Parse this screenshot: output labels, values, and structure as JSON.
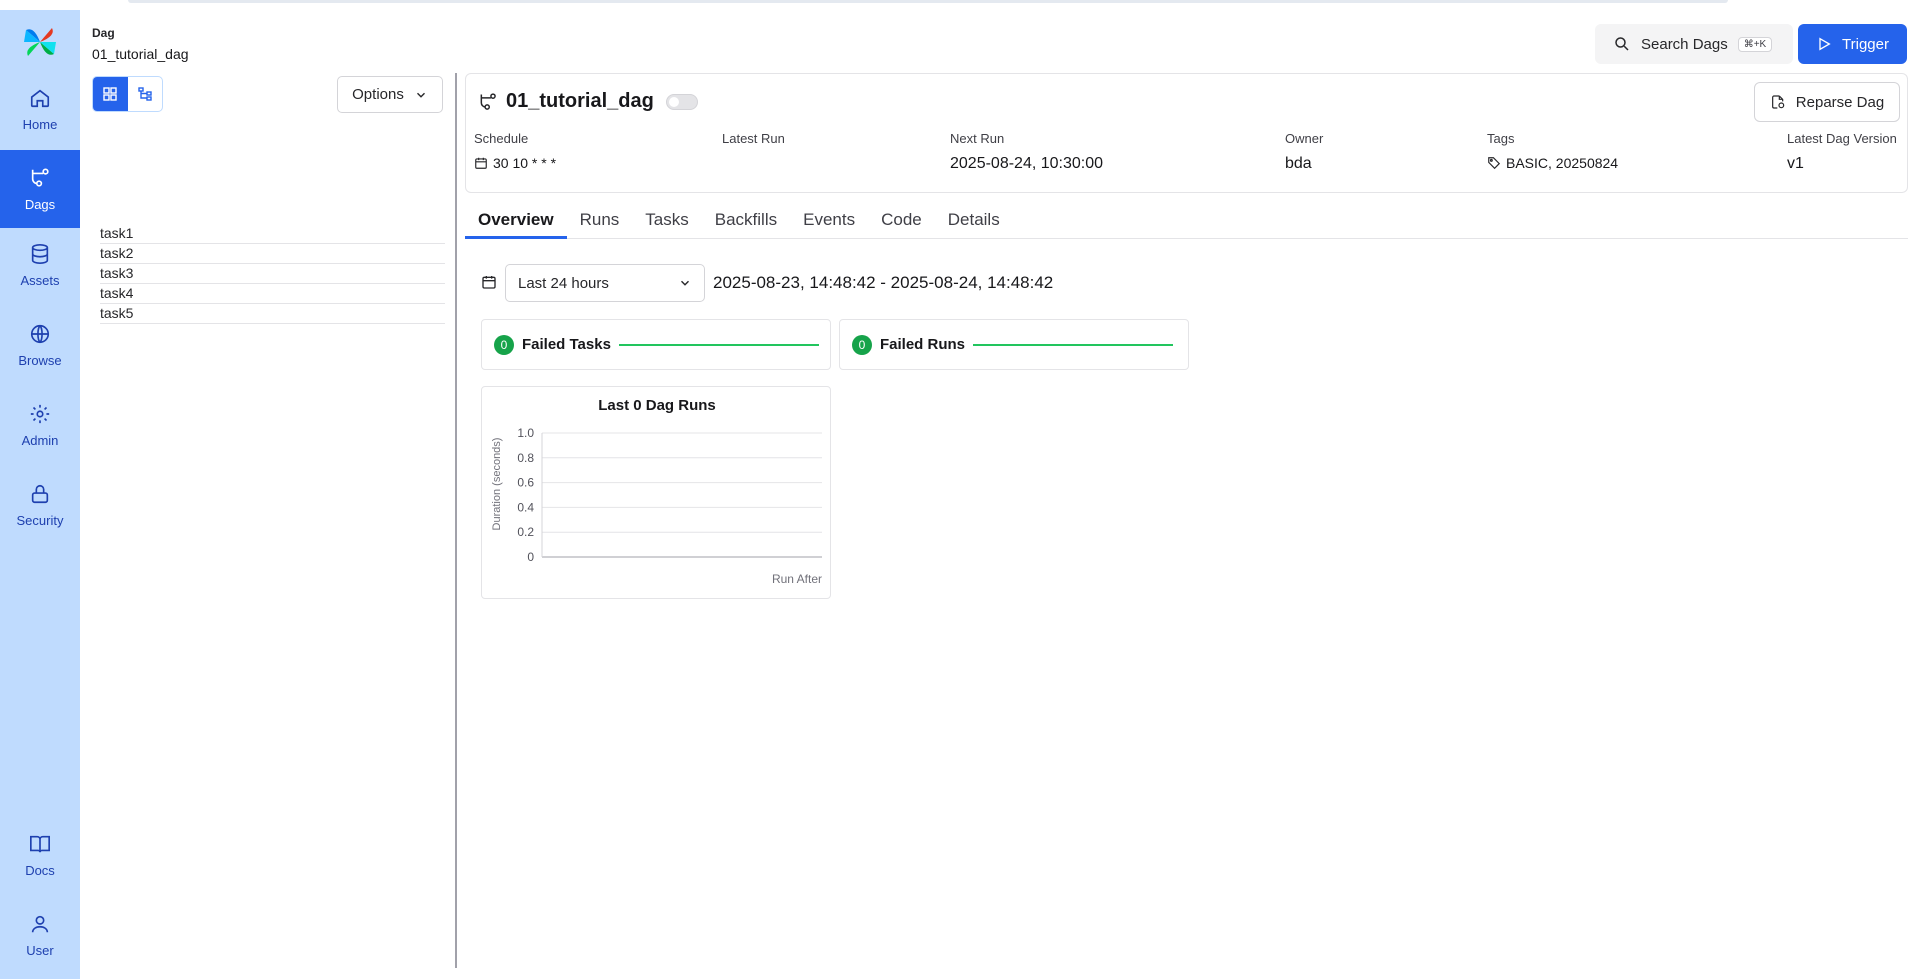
{
  "sidebar": {
    "logo": "airflow-pinwheel-logo",
    "items": [
      {
        "label": "Home",
        "icon": "home-icon"
      },
      {
        "label": "Dags",
        "icon": "dag-icon",
        "active": true
      },
      {
        "label": "Assets",
        "icon": "database-icon"
      },
      {
        "label": "Browse",
        "icon": "globe-icon"
      },
      {
        "label": "Admin",
        "icon": "gear-icon"
      },
      {
        "label": "Security",
        "icon": "lock-icon"
      }
    ],
    "bottom_items": [
      {
        "label": "Docs",
        "icon": "book-icon"
      },
      {
        "label": "User",
        "icon": "user-icon"
      }
    ]
  },
  "breadcrumb": {
    "label": "Dag",
    "value": "01_tutorial_dag"
  },
  "header": {
    "search_label": "Search Dags",
    "search_shortcut": "⌘+K",
    "trigger_label": "Trigger"
  },
  "left_panel": {
    "options_label": "Options",
    "tasks": [
      "task1",
      "task2",
      "task3",
      "task4",
      "task5"
    ]
  },
  "dag": {
    "title": "01_tutorial_dag",
    "reparse_label": "Reparse Dag",
    "schedule_label": "Schedule",
    "schedule_value": "30 10 * * *",
    "latest_run_label": "Latest Run",
    "latest_run_value": "",
    "next_run_label": "Next Run",
    "next_run_value": "2025-08-24, 10:30:00",
    "owner_label": "Owner",
    "owner_value": "bda",
    "tags_label": "Tags",
    "tags_value": "BASIC, 20250824",
    "version_label": "Latest Dag Version",
    "version_value": "v1"
  },
  "tabs": [
    "Overview",
    "Runs",
    "Tasks",
    "Backfills",
    "Events",
    "Code",
    "Details"
  ],
  "active_tab": "Overview",
  "overview": {
    "range_select": "Last 24 hours",
    "range_text": "2025-08-23, 14:48:42 - 2025-08-24, 14:48:42",
    "failed_tasks": {
      "count": "0",
      "label": "Failed Tasks"
    },
    "failed_runs": {
      "count": "0",
      "label": "Failed Runs"
    }
  },
  "colors": {
    "accent": "#2563eb",
    "sidebar_bg": "#bfdbfe",
    "success": "#16a34a"
  },
  "chart_data": {
    "type": "bar",
    "title": "Last 0 Dag Runs",
    "xlabel": "Run After",
    "ylabel": "Duration (seconds)",
    "ylim": [
      0,
      1.0
    ],
    "yticks": [
      "0",
      "0.2",
      "0.4",
      "0.6",
      "0.8",
      "1.0"
    ],
    "categories": [],
    "values": [],
    "grid": true
  }
}
